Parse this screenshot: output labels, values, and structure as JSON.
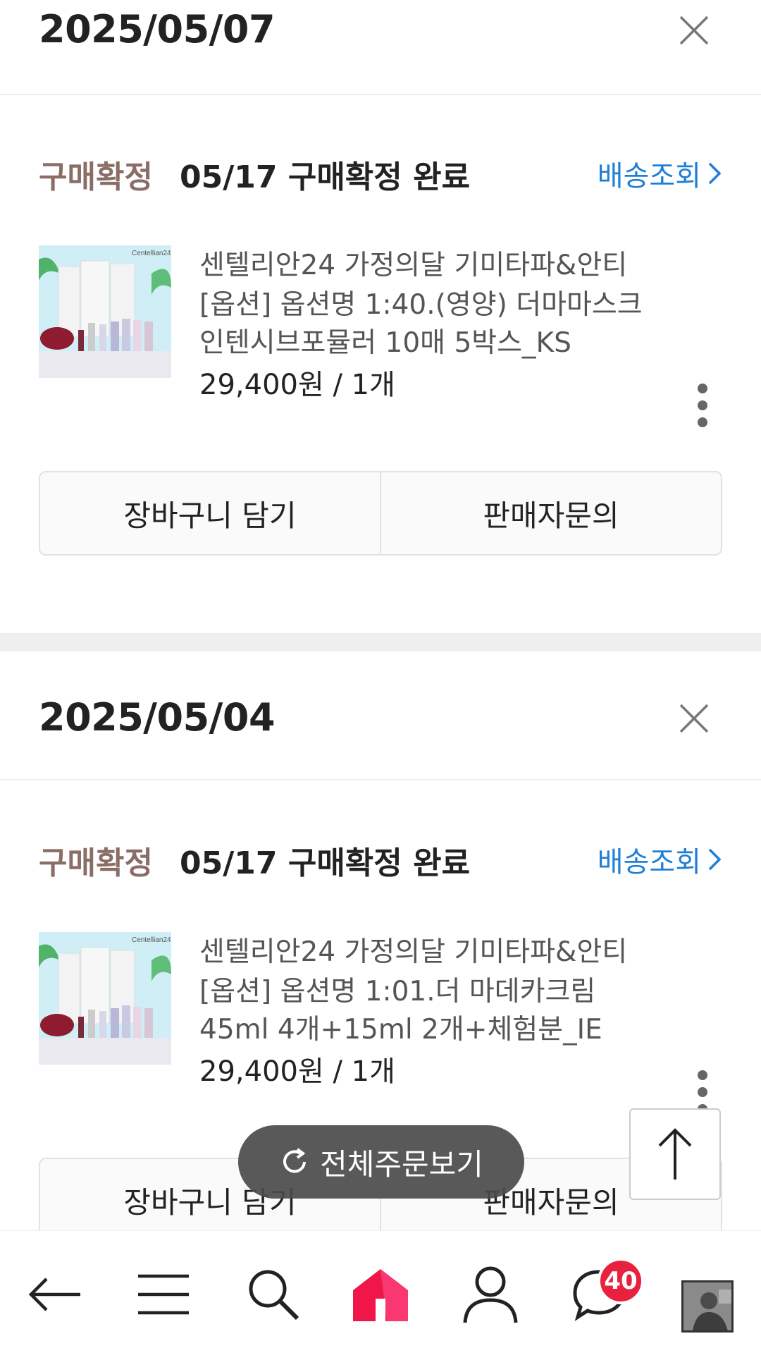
{
  "orders": [
    {
      "date": "2025/05/07",
      "status_badge": "구매확정",
      "status_text": "05/17 구매확정 완료",
      "track_label": "배송조회",
      "product_name": "센텔리안24 가정의달 기미타파&안티",
      "product_option": "[옵션] 옵션명 1:40.(영양) 더마마스크 인텐시브포뮬러 10매 5박스_KS",
      "product_price": "29,400원 / 1개",
      "cart_label": "장바구니 담기",
      "inquiry_label": "판매자문의",
      "thumb_brand": "Centellian24"
    },
    {
      "date": "2025/05/04",
      "status_badge": "구매확정",
      "status_text": "05/17 구매확정 완료",
      "track_label": "배송조회",
      "product_name": "센텔리안24 가정의달 기미타파&안티",
      "product_option": "[옵션] 옵션명 1:01.더 마데카크림 45ml 4개+15ml 2개+체험분_IE",
      "product_price": "29,400원 / 1개",
      "cart_label": "장바구니 담기",
      "inquiry_label": "판매자문의",
      "thumb_brand": "Centellian24"
    }
  ],
  "floating": {
    "all_orders_label": "전체주문보기"
  },
  "nav": {
    "chat_badge": "40",
    "icons": [
      "back-arrow-icon",
      "menu-icon",
      "search-icon",
      "home-icon",
      "person-icon",
      "chat-icon",
      "avatar"
    ]
  },
  "colors": {
    "status_badge": "#8a6e66",
    "link": "#1f7fd6",
    "home_accent": "#f0164a",
    "badge": "#e8213f"
  }
}
